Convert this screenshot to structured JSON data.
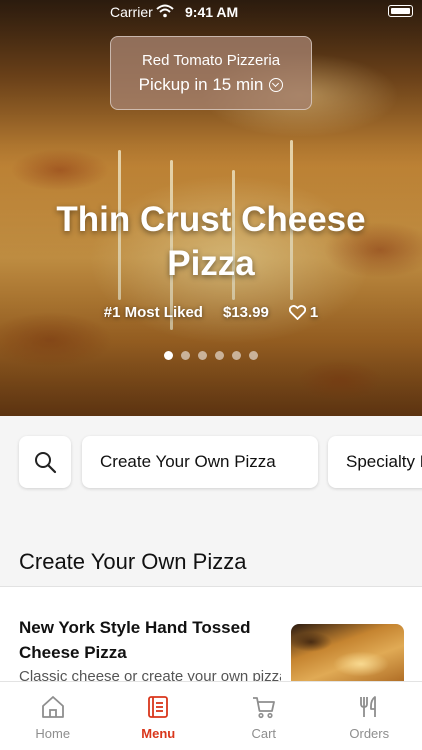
{
  "status_bar": {
    "carrier": "Carrier",
    "time": "9:41 AM"
  },
  "restaurant": {
    "name": "Red Tomato Pizzeria",
    "pickup": "Pickup in 15 min"
  },
  "hero": {
    "title": "Thin Crust Cheese Pizza",
    "rank": "#1 Most Liked",
    "price": "$13.99",
    "likes": "1",
    "page_count": 6,
    "active_page": 1
  },
  "categories": [
    "Create Your Own Pizza",
    "Specialty Pizza"
  ],
  "section": {
    "title": "Create Your Own Pizza"
  },
  "items": [
    {
      "name": "New York Style Hand Tossed Cheese Pizza",
      "description": "Classic cheese or create your own pizza"
    }
  ],
  "tabs": [
    {
      "label": "Home",
      "icon": "home-icon",
      "active": false
    },
    {
      "label": "Menu",
      "icon": "menu-icon",
      "active": true
    },
    {
      "label": "Cart",
      "icon": "cart-icon",
      "active": false
    },
    {
      "label": "Orders",
      "icon": "orders-icon",
      "active": false
    }
  ],
  "colors": {
    "accent": "#d9361b",
    "tab_inactive": "#8e8e8e",
    "background": "#f5f5f5"
  }
}
